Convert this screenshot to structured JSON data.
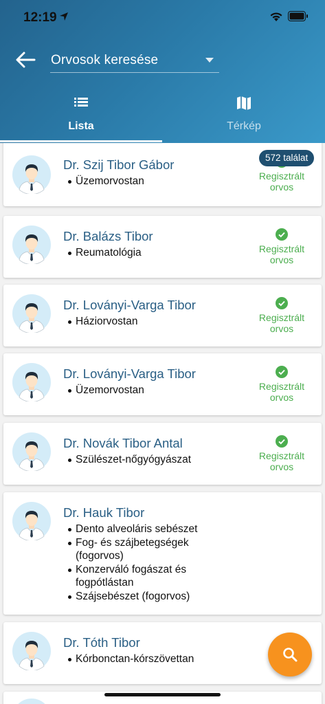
{
  "status": {
    "time": "12:19"
  },
  "header": {
    "search_value": "Orvosok keresése",
    "tabs": [
      {
        "label": "Lista",
        "icon": "list-icon",
        "active": true
      },
      {
        "label": "Térkép",
        "icon": "map-icon",
        "active": false
      }
    ]
  },
  "result_count": "572 találat",
  "doctors": [
    {
      "name": "Dr. Szij Tibor Gábor",
      "specialties": [
        "Üzemorvostan"
      ],
      "registered_label": "Regisztrált orvos"
    },
    {
      "name": "Dr. Balázs Tibor",
      "specialties": [
        "Reumatológia"
      ],
      "registered_label": "Regisztrált orvos"
    },
    {
      "name": "Dr. Loványi-Varga Tibor",
      "specialties": [
        "Háziorvostan"
      ],
      "registered_label": "Regisztrált orvos"
    },
    {
      "name": "Dr. Loványi-Varga Tibor",
      "specialties": [
        "Üzemorvostan"
      ],
      "registered_label": "Regisztrált orvos"
    },
    {
      "name": "Dr. Novák Tibor Antal",
      "specialties": [
        "Szülészet-nőgyógyászat"
      ],
      "registered_label": "Regisztrált orvos"
    },
    {
      "name": "Dr. Hauk Tibor",
      "specialties": [
        "Dento alveoláris sebészet",
        "Fog- és szájbetegségek (fogorvos)",
        "Konzerváló fogászat és fogpótlástan",
        "Szájsebészet (fogorvos)"
      ],
      "registered_label": ""
    },
    {
      "name": "Dr. Tóth Tibor",
      "specialties": [
        "Kórbonctan-kórszövettan"
      ],
      "registered_label": ""
    }
  ],
  "colors": {
    "accent": "#2a7aa8",
    "registered": "#4cae4f",
    "fab": "#f7921e",
    "name": "#2a5f85"
  },
  "fab_icon": "search-icon"
}
